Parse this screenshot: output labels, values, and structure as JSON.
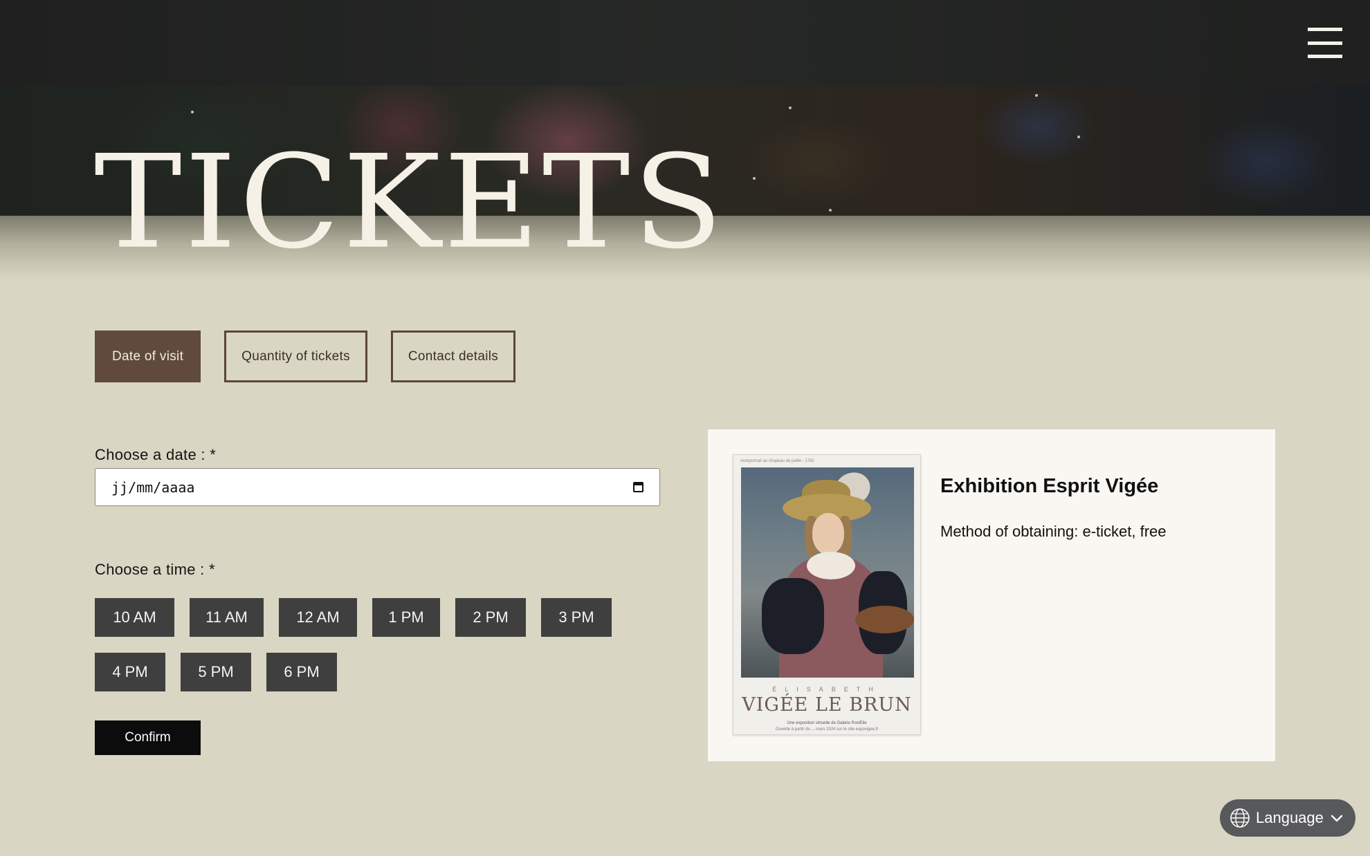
{
  "header": {
    "menu_icon": "hamburger-menu-icon"
  },
  "hero": {
    "title": "TICKETS"
  },
  "steps": [
    {
      "label": "Date of visit",
      "active": true
    },
    {
      "label": "Quantity of tickets",
      "active": false
    },
    {
      "label": "Contact details",
      "active": false
    }
  ],
  "form": {
    "date_label": "Choose a date : *",
    "date_placeholder": "jj/mm/aaaa",
    "date_icon": "calendar-icon",
    "time_label": "Choose a time : *",
    "times_row1": [
      "10 AM",
      "11 AM",
      "12 AM",
      "1 PM",
      "2 PM",
      "3 PM"
    ],
    "times_row2": [
      "4 PM",
      "5 PM",
      "6 PM"
    ],
    "confirm_label": "Confirm"
  },
  "exhibition": {
    "title": "Exhibition Esprit Vigée",
    "method": "Method of obtaining: e-ticket, free",
    "poster": {
      "top_caption": "Autoportrait au chapeau de paille - 1782",
      "name_small": "ÉLISABETH",
      "name_large": "VIGÉE LE BRUN",
      "line1": "Une exposition virtuelle de Galerie PostElle",
      "line2": "Ouverte à partir du ... mars 2024 sur le site expovigee.fr"
    }
  },
  "language": {
    "label": "Language",
    "icon": "globe-icon",
    "chevron": "chevron-down-icon"
  },
  "colors": {
    "background": "#dad6c4",
    "step_active": "#5f4a3c",
    "time_button": "#3f3f3f",
    "confirm": "#0c0c0c",
    "card": "#f9f7f1"
  }
}
